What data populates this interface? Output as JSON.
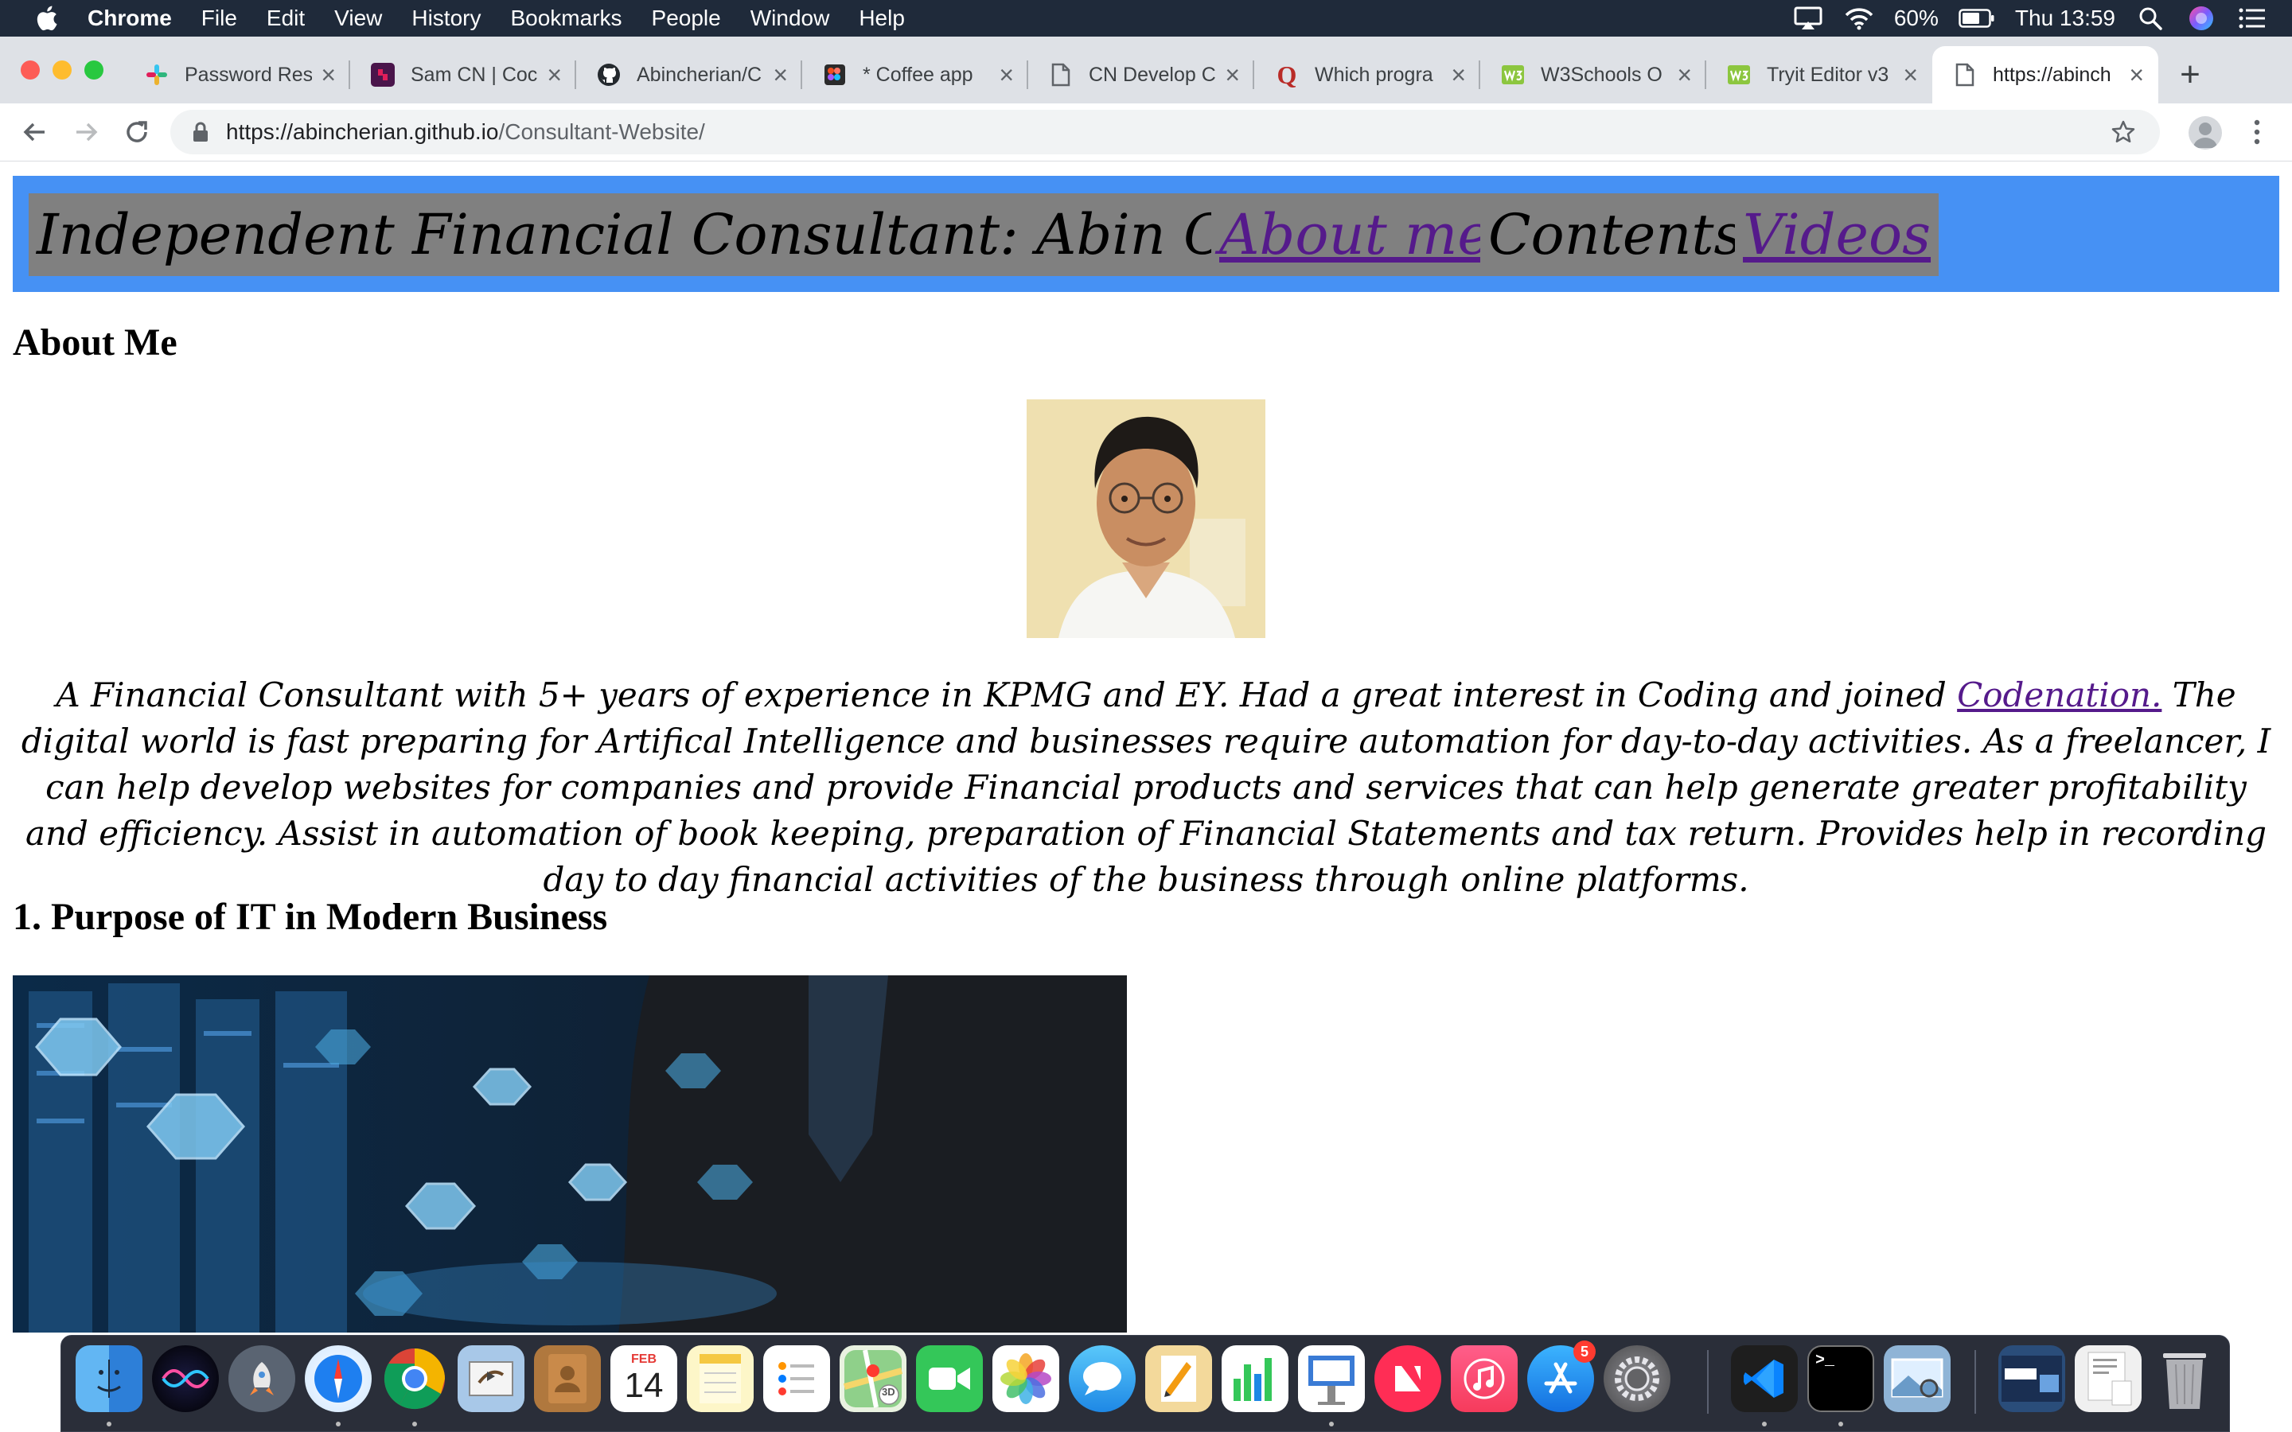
{
  "menubar": {
    "app": "Chrome",
    "items": [
      "File",
      "Edit",
      "View",
      "History",
      "Bookmarks",
      "People",
      "Window",
      "Help"
    ],
    "battery": "60%",
    "clock": "Thu 13:59"
  },
  "tabs": [
    {
      "title": "Password Res",
      "icon": "slack-icon"
    },
    {
      "title": "Sam CN | Coc",
      "icon": "slack-workspace-icon"
    },
    {
      "title": "Abincherian/C",
      "icon": "github-icon"
    },
    {
      "title": "* Coffee app",
      "icon": "figma-icon"
    },
    {
      "title": "CN Develop C",
      "icon": "document-icon"
    },
    {
      "title": "Which progra",
      "icon": "quora-icon"
    },
    {
      "title": "W3Schools O",
      "icon": "w3schools-icon"
    },
    {
      "title": "Tryit Editor v3",
      "icon": "w3schools-icon"
    },
    {
      "title": "https://abinch",
      "icon": "document-icon"
    }
  ],
  "address": {
    "host": "https://abincherian.github.io",
    "path": "/Consultant-Website/"
  },
  "page": {
    "nav": {
      "title": "Independent Financial Consultant: Abin Cherian",
      "about": "About me",
      "contents": "Contents",
      "videos": "Videos"
    },
    "about_heading": "About Me",
    "about_text_1": "A Financial Consultant with 5+ years of experience in KPMG and EY. Had a great interest in Coding and joined ",
    "about_link": "Codenation.",
    "about_text_2": " The digital world is fast preparing for Artifical Intelligence and businesses require automation for day-to-day activities. As a freelancer, I can help develop websites for companies and provide Financial products and services that can help generate greater profitability and efficiency. Assist in automation of book keeping, preparation of Financial Statements and tax return. Provides help in recording day to day financial activities of the business through online platforms.",
    "section1_heading": "1. Purpose of IT in Modern Business"
  },
  "dock": {
    "calendar_month": "FEB",
    "calendar_day": "14",
    "appstore_badge": "5",
    "maps_badge": "3D"
  },
  "colors": {
    "nav_bg": "#4691f4",
    "nav_item_bg": "#808080",
    "link": "#551a8b",
    "menubar_bg": "#1f2a3a"
  }
}
